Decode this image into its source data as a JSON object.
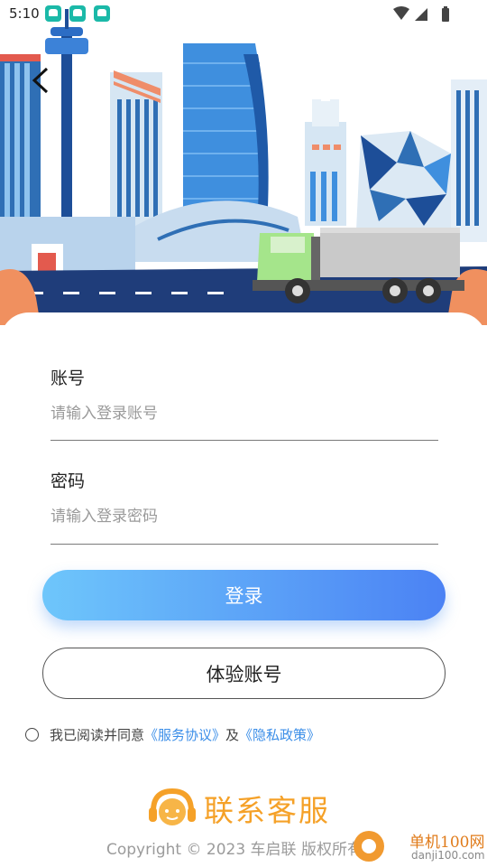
{
  "status_bar": {
    "time": "5:10"
  },
  "login": {
    "account_label": "账号",
    "account_placeholder": "请输入登录账号",
    "password_label": "密码",
    "password_placeholder": "请输入登录密码",
    "login_button": "登录",
    "trial_button": "体验账号"
  },
  "agreement": {
    "prefix": "我已阅读并同意",
    "service_link": "《服务协议》",
    "and": "及",
    "privacy_link": "《隐私政策》"
  },
  "footer": {
    "support_label": "联系客服",
    "copyright": "Copyright © 2023 车启联 版权所有"
  },
  "watermark": {
    "name": "单机100网",
    "url": "danji100.com"
  },
  "colors": {
    "primary_gradient_start": "#6ec6fb",
    "primary_gradient_end": "#4b82f4",
    "link": "#3b8ee8",
    "support": "#f5a128",
    "road": "#1f3d7a",
    "truck_cab": "#a5e58b"
  }
}
